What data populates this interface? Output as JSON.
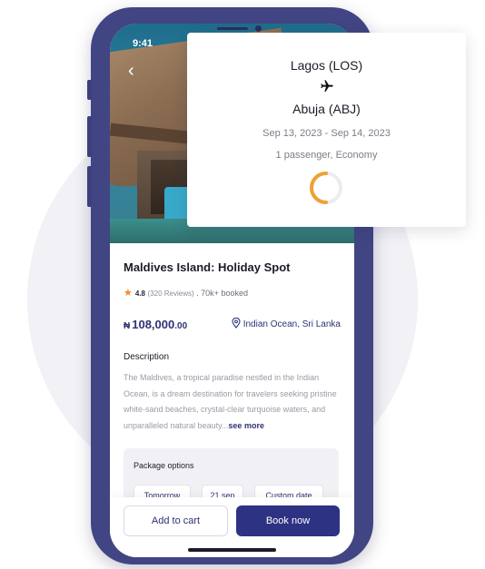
{
  "status_bar": {
    "time": "9:41"
  },
  "nav": {
    "back_icon": "chevron-left-icon"
  },
  "listing": {
    "title": "Maldives Island: Holiday Spot",
    "rating": "4.8",
    "review_count": "(320 Reviews)",
    "booked": ". 70k+ booked",
    "currency_symbol": "₦",
    "price_main": "108,000",
    "price_decimal": ".00",
    "location": "Indian Ocean, Sri Lanka"
  },
  "description": {
    "heading": "Description",
    "text": "The Maldives, a tropical paradise nestled in the Indian Ocean, is a dream destination for travelers seeking pristine white-sand beaches, crystal-clear turquoise waters, and unparalleled natural beauty...",
    "see_more": "see more"
  },
  "package": {
    "heading": "Package options",
    "options": [
      "Tomorrow",
      "21 sep",
      "Custom date"
    ]
  },
  "actions": {
    "add_to_cart": "Add to cart",
    "book_now": "Book now"
  },
  "flight": {
    "from": "Lagos (LOS)",
    "to": "Abuja (ABJ)",
    "plane_icon": "airplane-icon",
    "dates": "Sep 13, 2023 - Sep 14, 2023",
    "passengers": "1 passenger, Economy"
  },
  "colors": {
    "primary": "#2d3283",
    "phone_frame": "#414583",
    "star": "#f08a24",
    "spinner": "#f0a030"
  }
}
